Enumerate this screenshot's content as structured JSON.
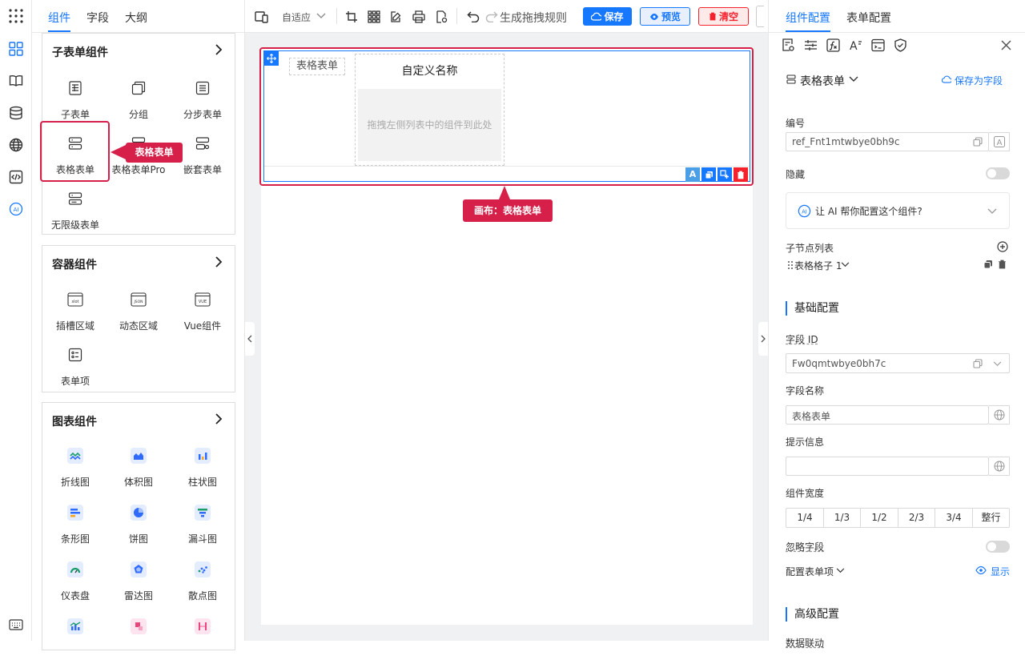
{
  "left_tabs": [
    "组件",
    "字段",
    "大纲"
  ],
  "groups": {
    "subform": {
      "title": "子表单组件",
      "items": [
        "子表单",
        "分组",
        "分步表单",
        "表格表单",
        "表格表单Pro",
        "嵌套表单",
        "无限级表单"
      ]
    },
    "container": {
      "title": "容器组件",
      "items": [
        "插槽区域",
        "动态区域",
        "Vue组件",
        "表单项"
      ],
      "icon_texts": [
        "slot",
        "JSON",
        "VUE"
      ]
    },
    "charts": {
      "title": "图表组件",
      "items": [
        "折线图",
        "体积图",
        "柱状图",
        "条形图",
        "饼图",
        "漏斗图",
        "仪表盘",
        "雷达图",
        "散点图"
      ]
    }
  },
  "callouts": {
    "left": "表格表单",
    "canvas": "画布：表格表单"
  },
  "toolbar": {
    "adaptive": "自适应",
    "gen_rules": "生成拖拽规则",
    "save": "保存",
    "preview": "预览",
    "clear": "清空"
  },
  "canvas": {
    "tag_label": "表格表单",
    "column_title": "自定义名称",
    "drop_hint": "拖拽左侧列表中的组件到此处",
    "mini_ai": "A"
  },
  "right": {
    "tabs": [
      "组件配置",
      "表单配置"
    ],
    "component_name": "表格表单",
    "save_as_field": "保存为字段",
    "id_label": "编号",
    "id_value": "ref_Fnt1mtwbye0bh9c",
    "hidden_label": "隐藏",
    "ai_prompt": "让 AI 帮你配置这个组件?",
    "children_label": "子节点列表",
    "child_item": "表格格子 1",
    "basic_title": "基础配置",
    "field_id_label": "字段 ID",
    "field_id_value": "Fw0qmtwbye0bh7c",
    "field_name_label": "字段名称",
    "field_name_value": "表格表单",
    "hint_label": "提示信息",
    "hint_value": "",
    "width_label": "组件宽度",
    "width_options": [
      "1/4",
      "1/3",
      "1/2",
      "2/3",
      "3/4",
      "整行"
    ],
    "ignore_label": "忽略字段",
    "config_item_label": "配置表单项",
    "show_label": "显示",
    "advanced_title": "高级配置",
    "data_link": "数据联动"
  },
  "colors": {
    "accent": "#1677ff",
    "highlight": "#d6204a",
    "danger": "#f5222d"
  }
}
